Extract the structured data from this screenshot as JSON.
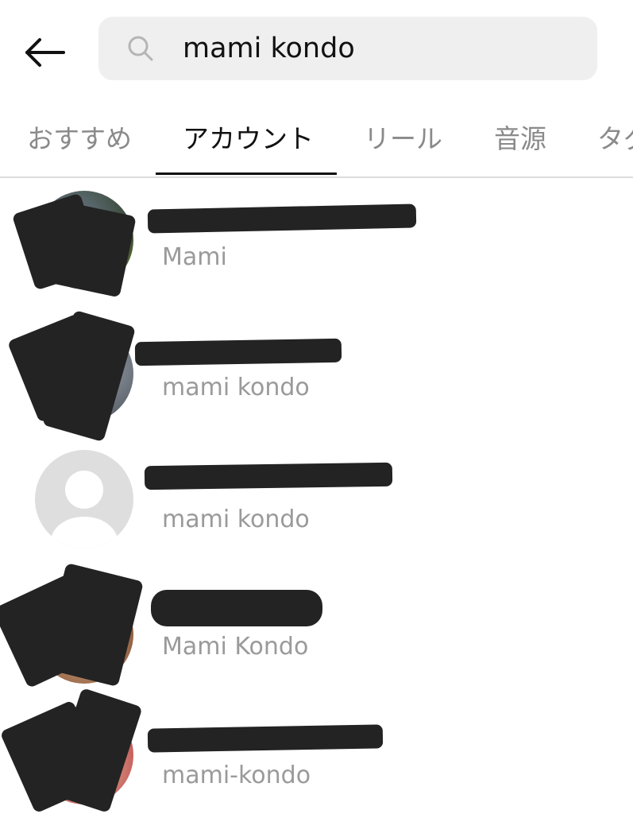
{
  "header": {
    "back_icon": "arrow-left-icon",
    "search_icon": "search-icon",
    "search_value": "mami kondo"
  },
  "tabs": [
    {
      "label": "おすすめ",
      "active": false
    },
    {
      "label": "アカウント",
      "active": true
    },
    {
      "label": "リール",
      "active": false
    },
    {
      "label": "音源",
      "active": false
    },
    {
      "label": "タグ",
      "active": false
    }
  ],
  "results": [
    {
      "subtitle": "Mami",
      "avatar": "photo"
    },
    {
      "subtitle": "mami kondo",
      "avatar": "photo"
    },
    {
      "subtitle": "mami kondo",
      "avatar": "default-person-icon"
    },
    {
      "subtitle": "Mami Kondo",
      "avatar": "photo"
    },
    {
      "subtitle": "mami-kondo",
      "avatar": "photo"
    }
  ],
  "colors": {
    "search_bg": "#efefef",
    "redaction": "#232323",
    "subtitle_text": "#9a9a9a",
    "inactive_tab": "#8a8a8a",
    "active_tab": "#111111"
  }
}
